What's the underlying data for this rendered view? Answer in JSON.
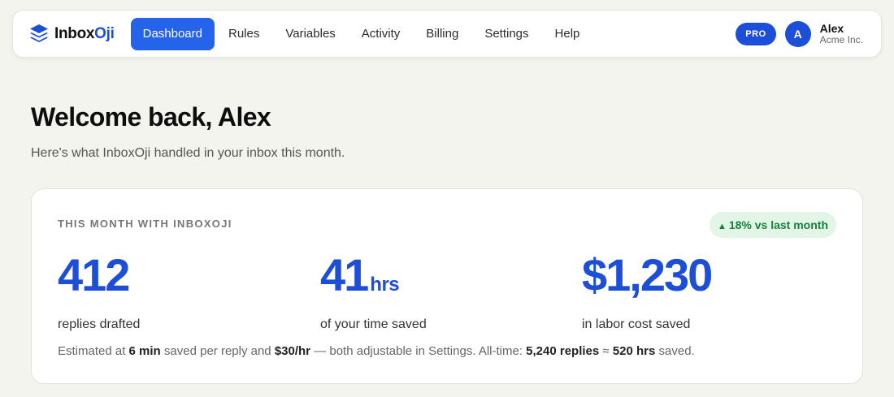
{
  "brand": {
    "name_main": "Inbox",
    "name_accent": "Oji",
    "icon": "stack-layers-icon",
    "accent_color": "#1d4ed8"
  },
  "nav": {
    "items": [
      {
        "label": "Dashboard",
        "active": true
      },
      {
        "label": "Rules",
        "active": false
      },
      {
        "label": "Variables",
        "active": false
      },
      {
        "label": "Activity",
        "active": false
      },
      {
        "label": "Billing",
        "active": false
      },
      {
        "label": "Settings",
        "active": false
      },
      {
        "label": "Help",
        "active": false
      }
    ]
  },
  "account": {
    "plan_badge": "PRO",
    "avatar_initial": "A",
    "name": "Alex",
    "org": "Acme Inc."
  },
  "page": {
    "title": "Welcome back, Alex",
    "subtitle": "Here's what InboxOji handled in your inbox this month."
  },
  "summary_card": {
    "label": "THIS MONTH WITH INBOXOJI",
    "trend": {
      "arrow": "▲",
      "text": "18% vs last month",
      "color": "#16803c"
    },
    "stats": [
      {
        "value": "412",
        "unit": "",
        "caption": "replies drafted"
      },
      {
        "value": "41",
        "unit": "hrs",
        "caption": "of your time saved"
      },
      {
        "value": "$1,230",
        "unit": "",
        "caption": "in labor cost saved"
      }
    ],
    "footnote": {
      "prefix": "Estimated at ",
      "minutes": "6 min",
      "mid1": " saved per reply and ",
      "rate": "$30/hr",
      "mid2": " — both adjustable in Settings. All-time: ",
      "all_time_replies": "5,240 replies",
      "approx": " ≈ ",
      "all_time_hours": "520 hrs",
      "suffix": " saved."
    }
  }
}
